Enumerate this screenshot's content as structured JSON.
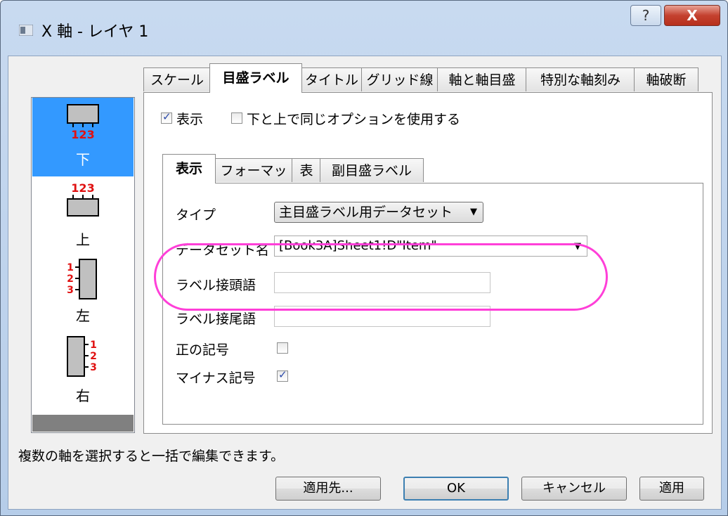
{
  "window": {
    "title": "X 軸 - レイヤ 1",
    "help_glyph": "?",
    "close_glyph": "X"
  },
  "sidebar": {
    "items": [
      {
        "label": "下",
        "numbers": "123",
        "selected": true
      },
      {
        "label": "上",
        "numbers": "123",
        "selected": false
      },
      {
        "label": "左",
        "numbers": "123",
        "selected": false
      },
      {
        "label": "右",
        "numbers": "123",
        "selected": false
      }
    ]
  },
  "outer_tabs": [
    "スケール",
    "目盛ラベル",
    "タイトル",
    "グリッド線",
    "軸と軸目盛",
    "特別な軸刻み",
    "軸破断"
  ],
  "options": {
    "show_label": "表示",
    "show_checked": true,
    "same_label": "下と上で同じオプションを使用する",
    "same_checked": false
  },
  "inner_tabs": [
    "表示",
    "フォーマット",
    "表",
    "副目盛ラベル"
  ],
  "form": {
    "type_label": "タイプ",
    "type_value": "主目盛ラベル用データセット",
    "dataset_label": "データセット名",
    "dataset_value": "[Book3A]Sheet1!D\"Item\"",
    "prefix_label": "ラベル接頭語",
    "suffix_label": "ラベル接尾語",
    "plus_label": "正の記号",
    "plus_checked": false,
    "minus_label": "マイナス記号",
    "minus_checked": true
  },
  "status_text": "複数の軸を選択すると一括で編集できます。",
  "buttons": {
    "apply_to": "適用先...",
    "ok": "OK",
    "cancel": "キャンセル",
    "apply": "適用"
  },
  "colors": {
    "selection": "#3399ff",
    "highlight": "#ff3fd8",
    "axis_numbers": "#e01010"
  }
}
